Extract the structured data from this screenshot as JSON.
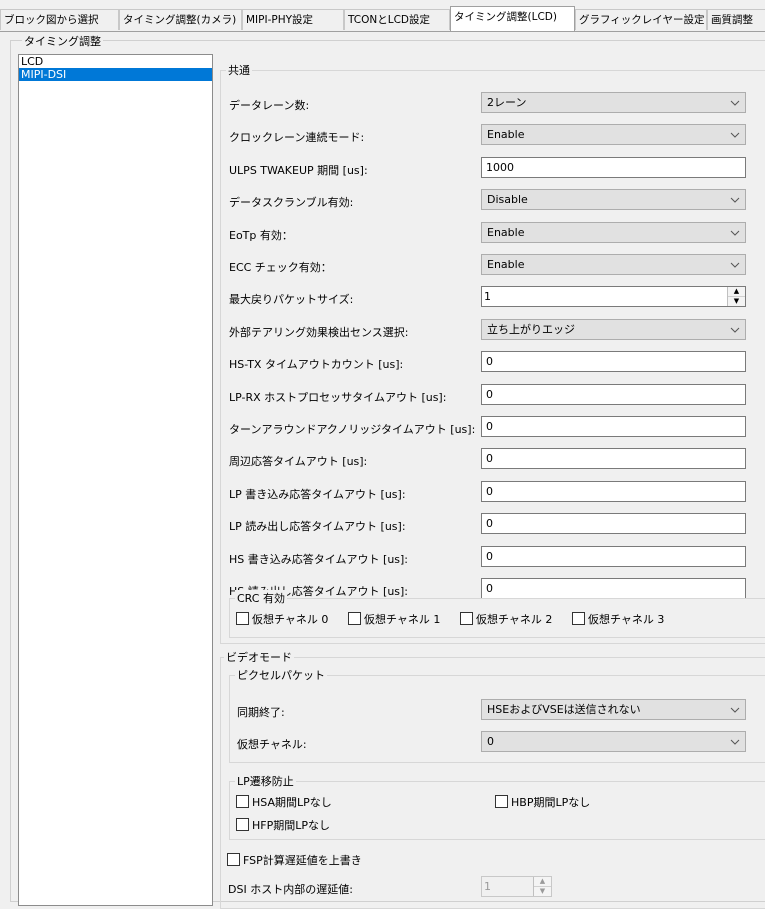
{
  "tabs": [
    "ブロック図から選択",
    "タイミング調整(カメラ)",
    "MIPI-PHY設定",
    "TCONとLCD設定",
    "タイミング調整(LCD)",
    "グラフィックレイヤー設定",
    "画質調整"
  ],
  "outer_group_label": "タイミング調整",
  "list": [
    "LCD",
    "MIPI-DSI"
  ],
  "common": {
    "legend": "共通",
    "rows": [
      {
        "label": "データレーン数:",
        "value": "2レーン"
      },
      {
        "label": "クロックレーン連続モード:",
        "value": "Enable"
      },
      {
        "label": "ULPS TWAKEUP 期間 [us]:",
        "value": "1000"
      },
      {
        "label": "データスクランブル有効:",
        "value": "Disable"
      },
      {
        "label": "EoTp 有効：",
        "value": "Enable"
      },
      {
        "label": "ECC チェック有効：",
        "value": "Enable"
      },
      {
        "label": "最大戻りパケットサイズ:",
        "value": "1"
      },
      {
        "label": "外部テアリング効果検出センス選択:",
        "value": "立ち上がりエッジ"
      },
      {
        "label": "HS-TX タイムアウトカウント [us]:",
        "value": "0"
      },
      {
        "label": "LP-RX ホストプロセッサタイムアウト [us]:",
        "value": "0"
      },
      {
        "label": "ターンアラウンドアクノリッジタイムアウト [us]:",
        "value": "0"
      },
      {
        "label": "周辺応答タイムアウト [us]:",
        "value": "0"
      },
      {
        "label": "LP 書き込み応答タイムアウト [us]:",
        "value": "0"
      },
      {
        "label": "LP 読み出し応答タイムアウト [us]:",
        "value": "0"
      },
      {
        "label": "HS 書き込み応答タイムアウト [us]:",
        "value": "0"
      },
      {
        "label": "HS 読み出し応答タイムアウト [us]:",
        "value": "0"
      }
    ],
    "crc_legend": "CRC 有効",
    "crc_channels": [
      "仮想チャネル 0",
      "仮想チャネル 1",
      "仮想チャネル 2",
      "仮想チャネル 3"
    ]
  },
  "video": {
    "legend": "ビデオモード",
    "pixel_legend": "ピクセルパケット",
    "sync_label": "同期終了:",
    "sync_value": "HSEおよびVSEは送信されない",
    "vc_label": "仮想チャネル:",
    "vc_value": "0",
    "lp_legend": "LP遷移防止",
    "hsa": "HSA期間LPなし",
    "hbp": "HBP期間LPなし",
    "hfp": "HFP期間LPなし",
    "fsp": "FSP計算遅延値を上書き",
    "delay_label": "DSI ホスト内部の遅延値:",
    "delay_value": "1"
  },
  "colors": {
    "selection": "#0078d7",
    "window": "#f0f0f0"
  }
}
